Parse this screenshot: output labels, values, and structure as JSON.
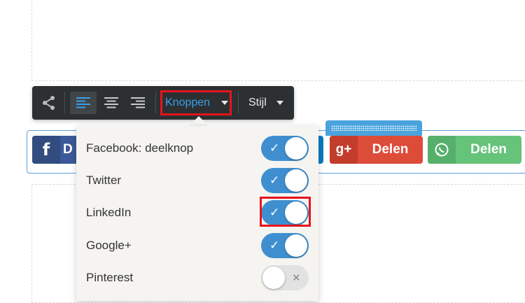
{
  "toolbar": {
    "dropdown_label": "Knoppen",
    "style_label": "Stijl"
  },
  "share_buttons": {
    "facebook": {
      "icon": "f",
      "label": "D"
    },
    "googleplus": {
      "icon": "g+",
      "label": "Delen"
    },
    "whatsapp": {
      "label": "Delen"
    }
  },
  "dropdown": {
    "items": [
      {
        "label": "Facebook: deelknop",
        "enabled": true,
        "mark": "✓"
      },
      {
        "label": "Twitter",
        "enabled": true,
        "mark": "✓"
      },
      {
        "label": "LinkedIn",
        "enabled": true,
        "mark": "✓"
      },
      {
        "label": "Google+",
        "enabled": true,
        "mark": "✓"
      },
      {
        "label": "Pinterest",
        "enabled": false,
        "mark": "✕"
      }
    ]
  }
}
